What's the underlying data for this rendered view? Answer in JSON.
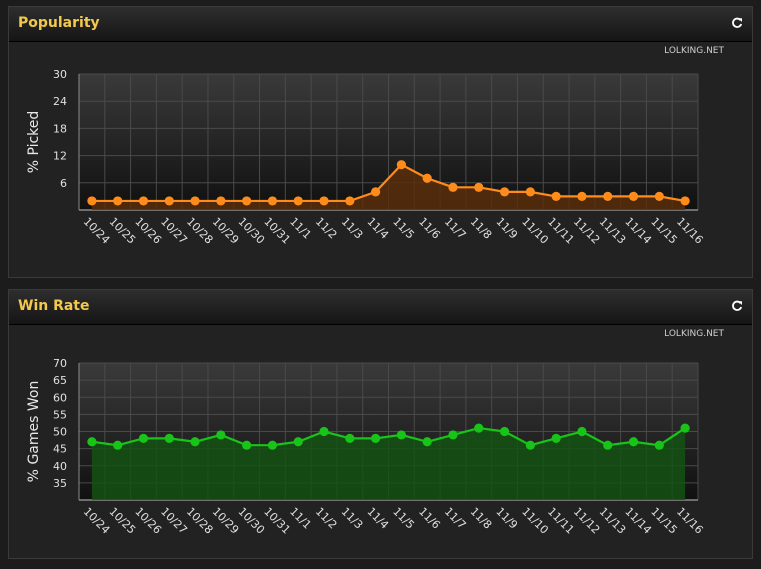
{
  "panels": [
    {
      "title": "Popularity",
      "credit": "LOLKING.NET"
    },
    {
      "title": "Win Rate",
      "credit": "LOLKING.NET"
    }
  ],
  "colors": {
    "background": "#1c1c1c",
    "title": "#f2c94c",
    "popularity_line": "#ff8c1a",
    "popularity_fill": "#5a2e0a",
    "winrate_line": "#18c418",
    "winrate_fill": "#145214"
  },
  "icons": {
    "refresh": "refresh-icon"
  },
  "chart_data": [
    {
      "type": "area",
      "title": "Popularity",
      "ylabel": "% Picked",
      "xlabel": "",
      "categories": [
        "10/24",
        "10/25",
        "10/26",
        "10/27",
        "10/28",
        "10/29",
        "10/30",
        "10/31",
        "11/1",
        "11/2",
        "11/3",
        "11/4",
        "11/5",
        "11/6",
        "11/7",
        "11/8",
        "11/9",
        "11/10",
        "11/11",
        "11/12",
        "11/13",
        "11/14",
        "11/15",
        "11/16"
      ],
      "values": [
        2,
        2,
        2,
        2,
        2,
        2,
        2,
        2,
        2,
        2,
        2,
        4,
        10,
        7,
        5,
        5,
        4,
        4,
        3,
        3,
        3,
        3,
        3,
        2
      ],
      "ylim": [
        0,
        30
      ],
      "yticks": [
        6,
        12,
        18,
        24,
        30
      ],
      "grid": true,
      "legend": "none"
    },
    {
      "type": "area",
      "title": "Win Rate",
      "ylabel": "% Games Won",
      "xlabel": "",
      "categories": [
        "10/24",
        "10/25",
        "10/26",
        "10/27",
        "10/28",
        "10/29",
        "10/30",
        "10/31",
        "11/1",
        "11/2",
        "11/3",
        "11/4",
        "11/5",
        "11/6",
        "11/7",
        "11/8",
        "11/9",
        "11/10",
        "11/11",
        "11/12",
        "11/13",
        "11/14",
        "11/15",
        "11/16"
      ],
      "values": [
        47,
        46,
        48,
        48,
        47,
        49,
        46,
        46,
        47,
        50,
        48,
        48,
        49,
        47,
        49,
        51,
        50,
        46,
        48,
        50,
        46,
        47,
        46,
        51
      ],
      "ylim": [
        30,
        70
      ],
      "yticks": [
        35,
        40,
        45,
        50,
        55,
        60,
        65,
        70
      ],
      "grid": true,
      "legend": "none"
    }
  ]
}
